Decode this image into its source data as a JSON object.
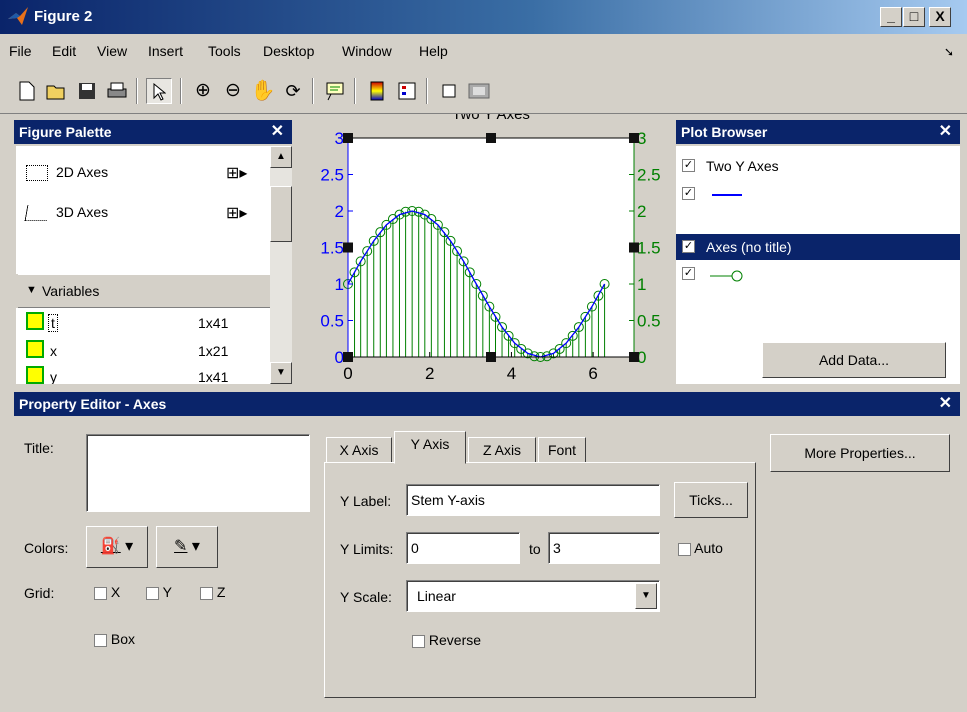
{
  "window": {
    "title": "Figure 2",
    "min": "_",
    "max": "□",
    "close": "X"
  },
  "menu": {
    "items": [
      "File",
      "Edit",
      "View",
      "Insert",
      "Tools",
      "Desktop",
      "Window",
      "Help"
    ]
  },
  "toolbar": {
    "icons": [
      "new-figure-icon",
      "open-file-icon",
      "save-icon",
      "print-icon",
      "select-arrow-icon",
      "zoom-in-icon",
      "zoom-out-icon",
      "pan-hand-icon",
      "rotate-3d-icon",
      "data-cursor-icon",
      "colorbar-icon",
      "legend-icon",
      "hide-plot-tools-icon",
      "show-plot-tools-icon"
    ]
  },
  "palette": {
    "title": "Figure Palette",
    "close": "✕",
    "axes2d": "2D Axes",
    "axes3d": "3D Axes",
    "variables_header": "Variables",
    "variables": [
      {
        "name": "t",
        "size": "1x41"
      },
      {
        "name": "x",
        "size": "1x21"
      },
      {
        "name": "y",
        "size": "1x41"
      }
    ]
  },
  "chart_data": {
    "type": "line",
    "title": "Two Y Axes",
    "xlim": [
      0,
      7
    ],
    "ylim": [
      0,
      3
    ],
    "xticks": [
      "0",
      "2",
      "4",
      "6"
    ],
    "yticks": [
      "0",
      "0.5",
      "1",
      "1.5",
      "2",
      "2.5",
      "3"
    ],
    "left_axis_color": "#0000ff",
    "right_axis_color": "#008000",
    "series": [
      {
        "type": "line",
        "color": "#0000ff",
        "x": [
          0,
          0.31,
          0.63,
          0.94,
          1.26,
          1.57,
          1.88,
          2.2,
          2.51,
          2.83,
          3.14,
          3.46,
          3.77,
          4.08,
          4.4,
          4.71,
          5.03,
          5.34,
          5.65,
          5.97,
          6.28
        ],
        "y": [
          1,
          1.31,
          1.59,
          1.81,
          1.95,
          2,
          1.95,
          1.81,
          1.59,
          1.31,
          1,
          0.69,
          0.41,
          0.19,
          0.05,
          0,
          0.05,
          0.19,
          0.41,
          0.69,
          1
        ]
      },
      {
        "type": "stem",
        "color": "#008000",
        "x": [
          0,
          0.16,
          0.31,
          0.47,
          0.63,
          0.79,
          0.94,
          1.1,
          1.26,
          1.41,
          1.57,
          1.73,
          1.88,
          2.04,
          2.2,
          2.36,
          2.51,
          2.67,
          2.83,
          2.98,
          3.14,
          3.3,
          3.46,
          3.61,
          3.77,
          3.93,
          4.08,
          4.24,
          4.4,
          4.56,
          4.71,
          4.87,
          5.03,
          5.18,
          5.34,
          5.5,
          5.65,
          5.81,
          5.97,
          6.13,
          6.28
        ],
        "y": [
          1,
          1.16,
          1.31,
          1.45,
          1.59,
          1.71,
          1.81,
          1.89,
          1.95,
          1.99,
          2,
          1.99,
          1.95,
          1.89,
          1.81,
          1.71,
          1.59,
          1.45,
          1.31,
          1.16,
          1,
          0.84,
          0.69,
          0.55,
          0.41,
          0.29,
          0.19,
          0.11,
          0.05,
          0.01,
          0,
          0.01,
          0.05,
          0.11,
          0.19,
          0.29,
          0.41,
          0.55,
          0.69,
          0.84,
          1
        ]
      }
    ]
  },
  "browser": {
    "title": "Plot Browser",
    "close": "✕",
    "items": [
      {
        "label": "Two Y Axes",
        "checked": true
      },
      {
        "label": "",
        "checked": true,
        "legend": "line"
      },
      {
        "label": "Axes (no title)",
        "checked": true,
        "selected": true
      },
      {
        "label": "",
        "checked": true,
        "legend": "stem"
      }
    ],
    "add_data": "Add Data..."
  },
  "editor": {
    "title": "Property Editor - Axes",
    "close": "✕",
    "title_label": "Title:",
    "title_value": "",
    "colors_label": "Colors:",
    "grid_label": "Grid:",
    "grid_x": "X",
    "grid_y": "Y",
    "grid_z": "Z",
    "box_label": "Box",
    "tabs": [
      "X Axis",
      "Y Axis",
      "Z Axis",
      "Font"
    ],
    "active_tab": "Y Axis",
    "ylabel_label": "Y Label:",
    "ylabel_value": "Stem Y-axis",
    "ticks_button": "Ticks...",
    "ylimits_label": "Y Limits:",
    "ylim_min": "0",
    "to_label": "to",
    "ylim_max": "3",
    "auto_label": "Auto",
    "yscale_label": "Y Scale:",
    "yscale_value": "Linear",
    "reverse_label": "Reverse",
    "more_props": "More Properties..."
  }
}
